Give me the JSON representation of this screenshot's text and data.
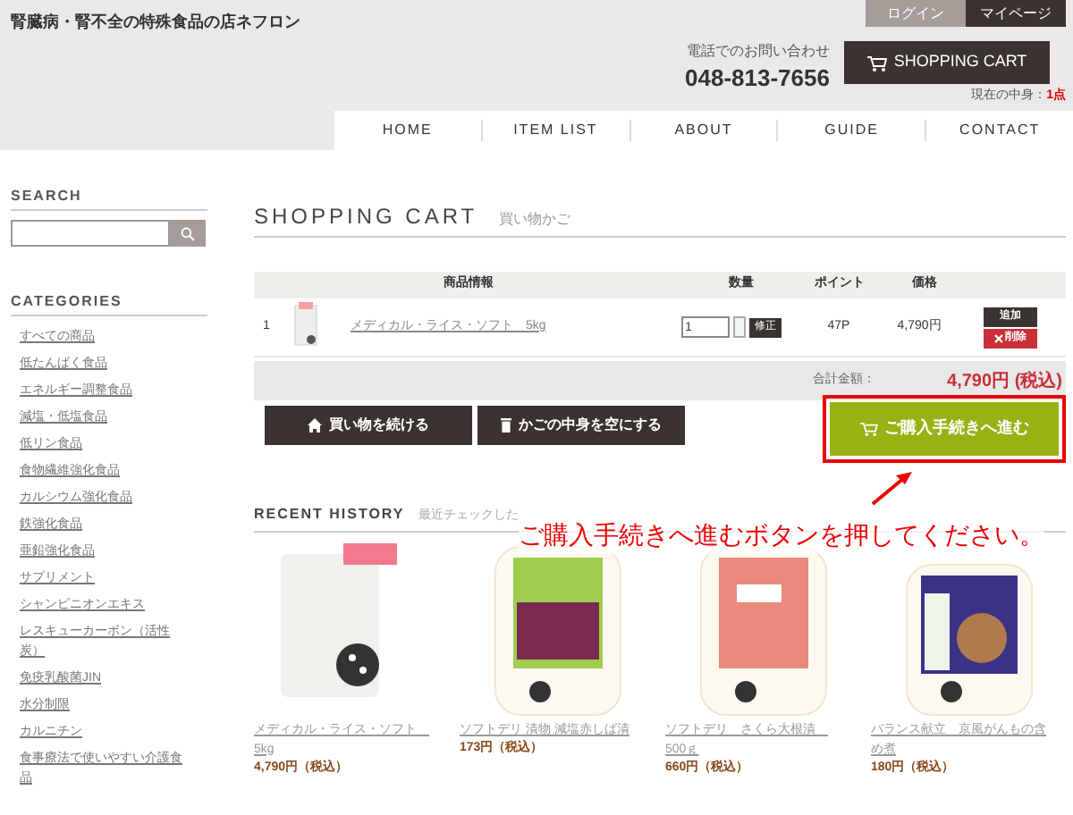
{
  "header": {
    "site_title": "腎臓病・腎不全の特殊食品の店ネフロン",
    "account_tabs": [
      {
        "label": "ログイン",
        "selected": false
      },
      {
        "label": "マイページ",
        "selected": true
      }
    ],
    "phone_label": "電話でのお問い合わせ",
    "phone": "048-813-7656",
    "cart_button": "SHOPPING CART",
    "cart_status_label": "現在の中身：",
    "cart_count": "1点"
  },
  "nav": [
    "HOME",
    "ITEM LIST",
    "ABOUT",
    "GUIDE",
    "CONTACT"
  ],
  "sidebar": {
    "search_heading": "SEARCH",
    "categories_heading": "CATEGORIES",
    "categories": [
      "すべての商品",
      "低たんぱく食品",
      "エネルギー調整食品",
      "減塩・低塩食品",
      "低リン食品",
      "食物繊維強化食品",
      "カルシウム強化食品",
      "鉄強化食品",
      "亜鉛強化食品",
      "サプリメント",
      "シャンピニオンエキス",
      "レスキューカーボン（活性炭）",
      "免疫乳酸菌JIN",
      "水分制限",
      "カルニチン",
      "食事療法で使いやすい介護食品"
    ]
  },
  "cart": {
    "title": "SHOPPING CART",
    "subtitle": "買い物かご",
    "columns": [
      "商品情報",
      "数量",
      "ポイント",
      "価格"
    ],
    "rows": [
      {
        "index": "1",
        "name": "メディカル・ライス・ソフト　5kg",
        "quantity": "1",
        "update": "修正",
        "points": "47P",
        "price": "4,790円",
        "add": "追加",
        "delete": "削除"
      }
    ],
    "total_label": "合計金額：",
    "total": "4,790円 (税込)",
    "continue_button": "買い物を続ける",
    "empty_button": "かごの中身を空にする",
    "checkout_button": "ご購入手続きへ進む"
  },
  "annotation": {
    "text": "ご購入手続きへ進むボタンを押してください。"
  },
  "recent": {
    "title": "RECENT HISTORY",
    "subtitle": "最近チェックした",
    "items": [
      {
        "name": "メディカル・ライス・ソフト　5kg",
        "price": "4,790円（税込）",
        "kind": "picture"
      },
      {
        "name": "ソフトデリ 漬物 減塩赤しば漬",
        "price": "173円（税込）",
        "kind": "picture"
      },
      {
        "name": "ソフトデリ　さくら大根漬　500ｇ",
        "price": "660円（税込）",
        "kind": "picture"
      },
      {
        "name": "バランス献立　京風がんもの含め煮",
        "price": "180円（税込）",
        "kind": "picture"
      }
    ]
  }
}
